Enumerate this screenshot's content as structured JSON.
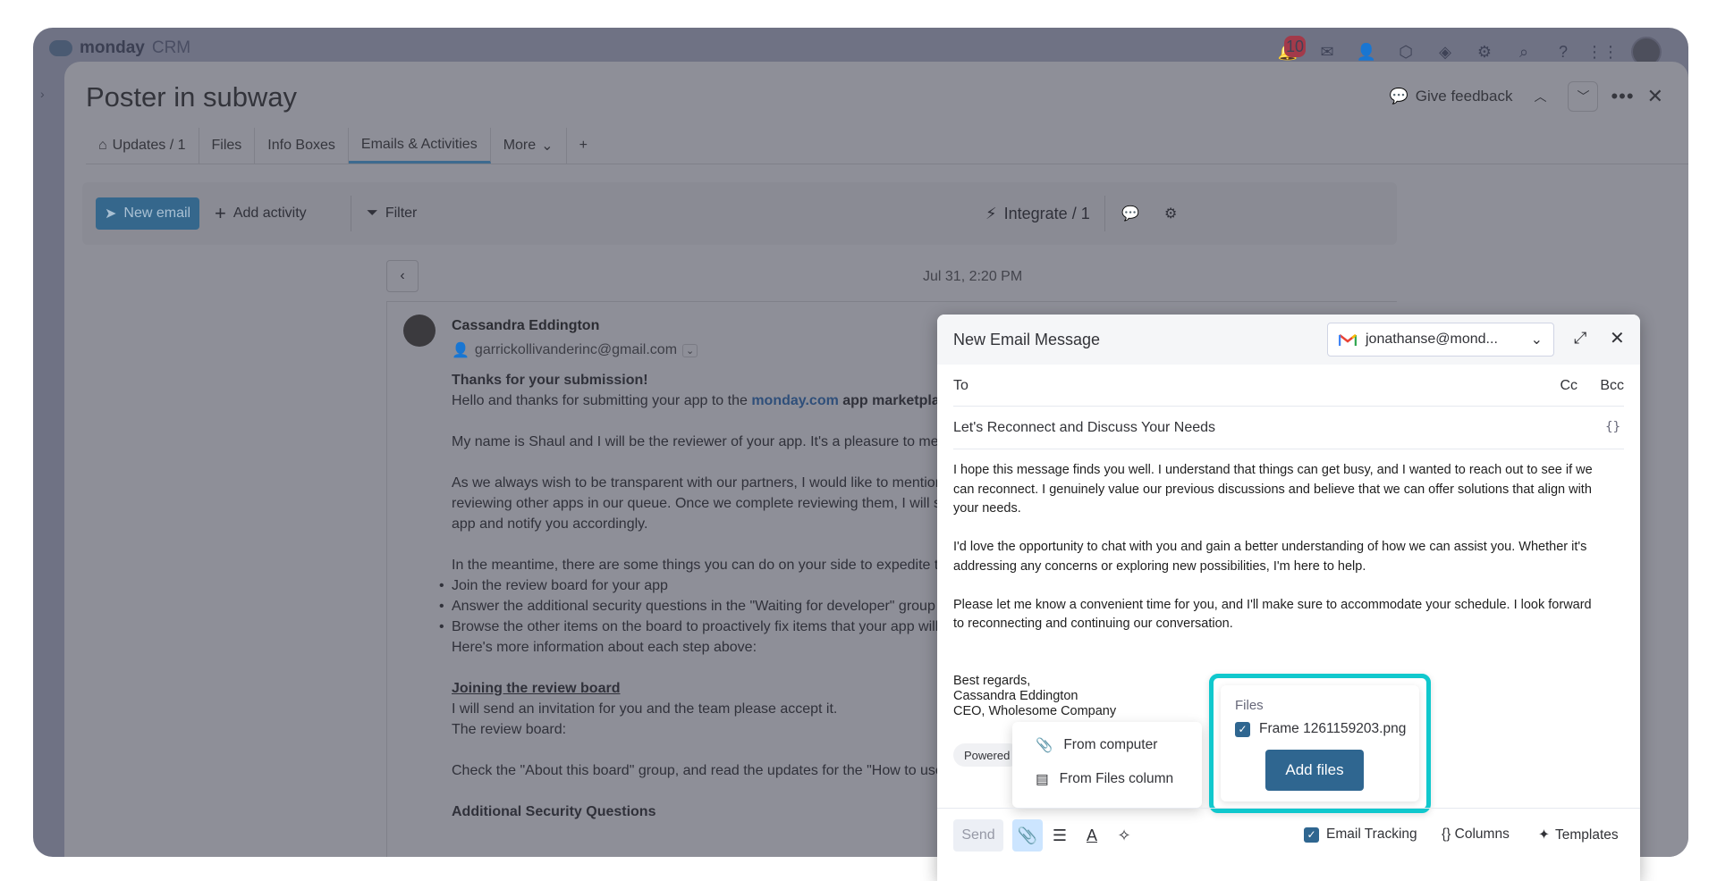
{
  "app": {
    "brand": "monday",
    "brand_suffix": "CRM",
    "notifications_count": "10"
  },
  "item": {
    "title": "Poster in subway",
    "give_feedback": "Give feedback",
    "tabs": [
      {
        "label": "Updates / 1"
      },
      {
        "label": "Files"
      },
      {
        "label": "Info Boxes"
      },
      {
        "label": "Emails & Activities"
      },
      {
        "label": "More"
      },
      {
        "label": "+"
      }
    ]
  },
  "toolbar": {
    "new_email": "New email",
    "add_activity": "Add activity",
    "filter": "Filter",
    "integrate": "Integrate / 1"
  },
  "feed": {
    "date": "Jul 31, 2:20 PM",
    "sender_name": "Cassandra Eddington",
    "sender_email": "garrickollivanderinc@gmail.com",
    "greeting": "Thanks for your submission!",
    "line1_a": "Hello and thanks for submitting your app to the ",
    "line1_link": "monday.com",
    "line1_b": " app marketplace!",
    "line2": "My name is Shaul and I will be the reviewer of your app. It's a pleasure to meet you",
    "line3": "As we always wish to be transparent with our partners, I would like to mention tha",
    "line4": "reviewing other apps in our queue. Once we complete reviewing them, I will start",
    "line5": "app and notify you accordingly.",
    "line6": "In the meantime, there are some things you can do on your side to expedite the p",
    "bullets": [
      "Join the review board for your app",
      "Answer the additional security questions in the \"Waiting for developer\" group",
      "Browse the other items on the board to proactively fix items that your app will not"
    ],
    "line7": "Here's more information about each step above:",
    "heading1": "Joining the review board",
    "line8": "I will send an invitation for you and the team please accept it.",
    "line9": "The review board:",
    "line10": "Check the \"About this board\" group, and read the updates for the \"How to use thi",
    "heading2": "Additional Security Questions"
  },
  "compose": {
    "title": "New Email Message",
    "account": "jonathanse@mond...",
    "to_label": "To",
    "cc": "Cc",
    "bcc": "Bcc",
    "subject": "Let's Reconnect and Discuss Your Needs",
    "variables": "{}",
    "para1_l1": "I hope this message finds you well. I understand that things can get busy, and I wanted to reach out to see if we",
    "para1_l2": "can reconnect. I genuinely value our previous discussions and believe that we can offer solutions that align with",
    "para1_l3": "your needs.",
    "para2_l1": "I'd love the opportunity to chat with you and gain a better understanding of how we can assist you. Whether it's",
    "para2_l2": "addressing any concerns or exploring new possibilities, I'm here to help.",
    "para3_l1": "Please let me know a convenient time for you, and I'll make sure to accommodate your schedule. I look forward",
    "para3_l2": "to reconnecting and continuing our conversation.",
    "sig1": "Best regards,",
    "sig2": "Cassandra Eddington",
    "sig3": "CEO, Wholesome Company",
    "powered": "Powered",
    "send": "Send",
    "email_tracking": "Email Tracking",
    "columns": "{} Columns",
    "templates": "Templates"
  },
  "attach_menu": {
    "from_computer": "From computer",
    "from_files_column": "From Files column"
  },
  "files_popover": {
    "label": "Files",
    "file_name": "Frame 1261159203.png",
    "add_files": "Add files",
    "highlight_color": "#10c8cd"
  }
}
